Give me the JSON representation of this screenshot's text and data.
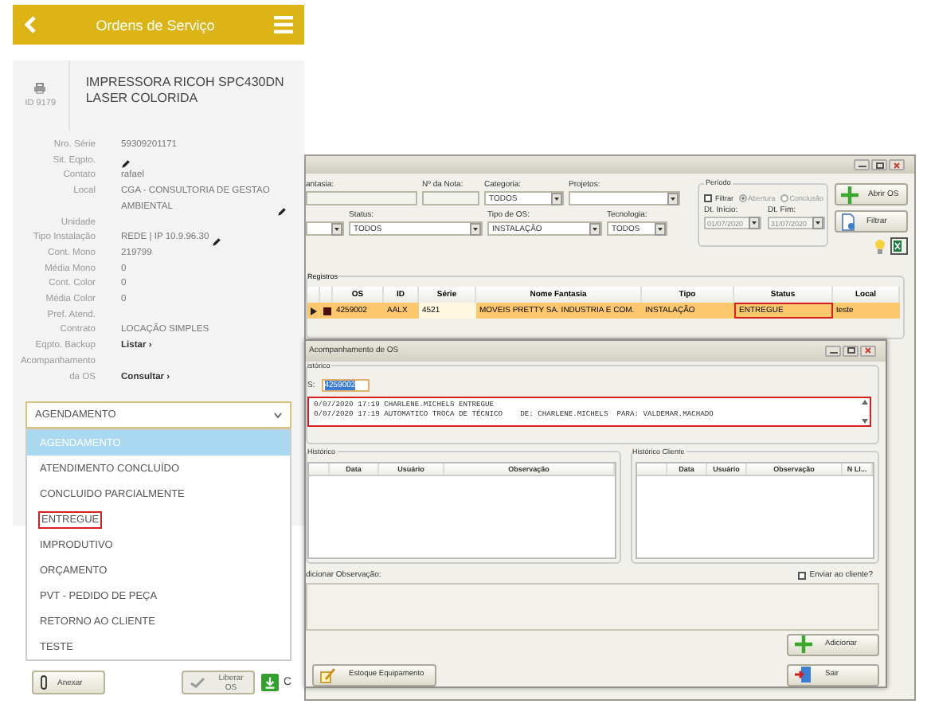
{
  "mobile": {
    "header": {
      "title": "Ordens de Serviço"
    },
    "equipment": {
      "id": "ID 9179",
      "name": "IMPRESSORA RICOH SPC430DN LASER COLORIDA"
    },
    "fields": [
      {
        "label": "Nro. Série",
        "value": "59309201171",
        "kind": "text",
        "editable": false
      },
      {
        "label": "Sit. Eqpto.",
        "kind": "text",
        "editable": true
      },
      {
        "label": "Contato",
        "value": "rafael",
        "kind": "text",
        "editable": false
      },
      {
        "label": "Local",
        "value": "CGA - CONSULTORIA DE GESTAO AMBIENTAL",
        "kind": "text",
        "editable": true
      },
      {
        "label": "Unidade",
        "kind": "text",
        "editable": false
      },
      {
        "label": "Tipo Instalação",
        "value": "REDE | IP 10.9.96.30",
        "kind": "text",
        "editable": true
      },
      {
        "label": "Cont. Mono",
        "value": "219799",
        "kind": "text",
        "editable": false
      },
      {
        "label": "Média Mono",
        "value": "0",
        "kind": "text",
        "editable": false
      },
      {
        "label": "Cont. Color",
        "value": "0",
        "kind": "text",
        "editable": false
      },
      {
        "label": "Média Color",
        "value": "0",
        "kind": "text",
        "editable": false
      },
      {
        "label": "Pref. Atend.",
        "kind": "text",
        "editable": false
      },
      {
        "label": "Contrato",
        "value": "LOCAÇÃO SIMPLES",
        "kind": "text",
        "editable": false
      },
      {
        "label": "Eqpto. Backup",
        "value": "Listar ›",
        "kind": "link",
        "editable": false
      },
      {
        "label": "Acompanhamento da OS",
        "value": "Consultar ›",
        "kind": "link",
        "editable": false
      }
    ],
    "status_select": {
      "value": "AGENDAMENTO",
      "expanded": true,
      "options": [
        {
          "label": "AGENDAMENTO",
          "selected": true,
          "marked": false
        },
        {
          "label": "ATENDIMENTO CONCLUÍDO",
          "selected": false,
          "marked": false
        },
        {
          "label": "CONCLUIDO PARCIALMENTE",
          "selected": false,
          "marked": false
        },
        {
          "label": "ENTREGUE",
          "selected": false,
          "marked": true
        },
        {
          "label": "IMPRODUTIVO",
          "selected": false,
          "marked": false
        },
        {
          "label": "ORÇAMENTO",
          "selected": false,
          "marked": false
        },
        {
          "label": "PVT - PEDIDO DE PEÇA",
          "selected": false,
          "marked": false
        },
        {
          "label": "RETORNO AO CLIENTE",
          "selected": false,
          "marked": false
        },
        {
          "label": "TESTE",
          "selected": false,
          "marked": false
        }
      ]
    },
    "footer_buttons": [
      {
        "label": "Anexar",
        "kind": "attach",
        "disabled": false
      },
      {
        "label": "Liberar OS",
        "kind": "release",
        "disabled": true
      },
      {
        "label": "C",
        "kind": "download",
        "disabled": false
      }
    ]
  },
  "main_window": {
    "filter_rows": [
      {
        "fields": [
          {
            "label": "antasia:",
            "kind": "text"
          },
          {
            "label": "Nº da Nota:",
            "kind": "text"
          },
          {
            "label": "Categoria:",
            "kind": "select",
            "value": "TODOS"
          },
          {
            "label": "Projetos:",
            "kind": "select"
          }
        ]
      },
      {
        "fields": [
          {
            "kind": "select"
          },
          {
            "label": "Status:",
            "kind": "select",
            "value": "TODOS"
          },
          {
            "label": "Tipo de OS:",
            "kind": "select",
            "value": "INSTALAÇÃO"
          },
          {
            "label": "Tecnologia:",
            "kind": "select",
            "value": "TODOS"
          }
        ]
      }
    ],
    "period": {
      "title": "Período",
      "filter": {
        "label": "Filtrar",
        "checked": false
      },
      "radios": [
        {
          "label": "Abertura",
          "selected": true
        },
        {
          "label": "Conclusão",
          "selected": false
        }
      ],
      "dates": [
        {
          "label": "Dt. Início:",
          "value": "01/07/2020"
        },
        {
          "label": "Dt. Fim:",
          "value": "31/07/2020"
        }
      ]
    },
    "buttons": [
      {
        "label": "Abrir OS",
        "kind": "add"
      },
      {
        "label": "Filtrar",
        "kind": "filter"
      }
    ],
    "tools": [
      {
        "kind": "bulb"
      },
      {
        "kind": "excel"
      }
    ],
    "registros": {
      "title": "Registros",
      "columns": [
        "OS",
        "ID",
        "Série",
        "Nome Fantasia",
        "Tipo",
        "Status",
        "Local"
      ],
      "rows": [
        {
          "selected": true,
          "cells": [
            {
              "text": "4259002",
              "marked": false
            },
            {
              "text": "AALX",
              "marked": false
            },
            {
              "text": "4521",
              "marked": false
            },
            {
              "text": "MOVEIS PRETTY SA. INDUSTRIA E COM.",
              "marked": false
            },
            {
              "text": "INSTALAÇÃO",
              "marked": false
            },
            {
              "text": "ENTREGUE",
              "marked": true
            },
            {
              "text": "teste",
              "marked": false
            }
          ]
        }
      ]
    }
  },
  "dialog": {
    "title": "Acompanhamento de OS",
    "history_title": "istórico",
    "os_field": {
      "label": "S:",
      "value": "4259002",
      "text_selected": true
    },
    "log": {
      "marked": true,
      "lines": [
        "0/07/2020 17:19 CHARLENE.MICHELS ENTREGUE",
        "0/07/2020 17:19 AUTOMATICO TROCA DE TÉCNICO    DE: CHARLENE.MICHELS  PARA: VALDEMAR.MACHADO"
      ]
    },
    "grids": [
      {
        "title": "Histórico",
        "columns": [
          "Data",
          "Usuário",
          "Observação"
        ]
      },
      {
        "title": "Histórico Cliente",
        "columns": [
          "Data",
          "Usuário",
          "Observação",
          "N LI..."
        ]
      }
    ],
    "observation_label": "dicionar Observação:",
    "send_checkbox": {
      "label": "Enviar ao cliente?",
      "checked": false
    },
    "buttons": [
      {
        "label": "Adicionar",
        "kind": "add"
      },
      {
        "label": "Estoque Equipamento",
        "kind": "stock"
      },
      {
        "label": "Sair",
        "kind": "exit"
      }
    ]
  }
}
